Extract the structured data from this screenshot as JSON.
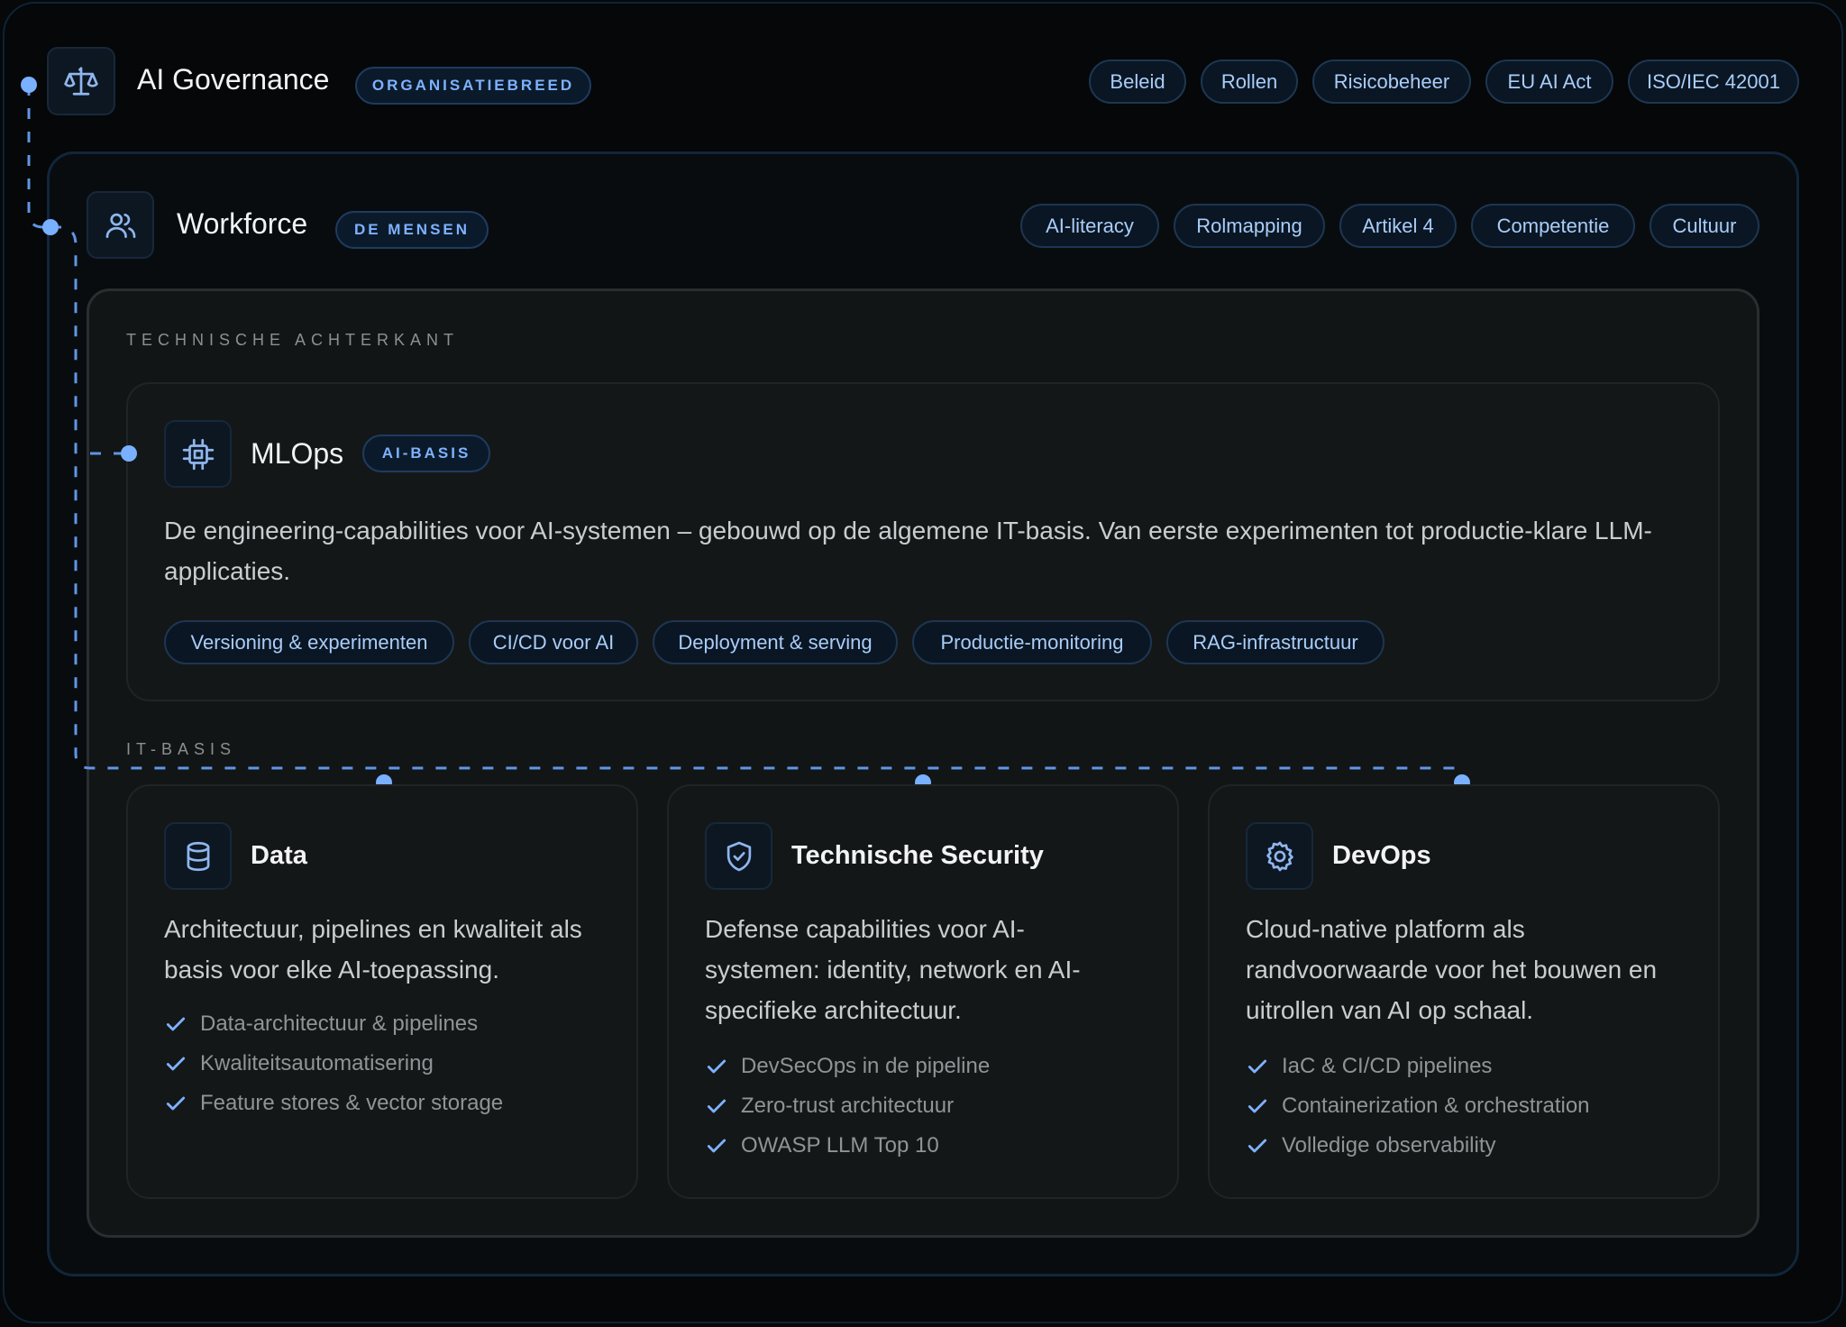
{
  "governance": {
    "title": "AI Governance",
    "badge": "ORGANISATIEBREED",
    "icon": "scale-icon",
    "tags": [
      "Beleid",
      "Rollen",
      "Risicobeheer",
      "EU AI Act",
      "ISO/IEC 42001"
    ]
  },
  "workforce": {
    "title": "Workforce",
    "badge": "DE MENSEN",
    "icon": "users-icon",
    "tags": [
      "AI-literacy",
      "Rolmapping",
      "Artikel 4",
      "Competentie",
      "Cultuur"
    ]
  },
  "technical": {
    "section_label": "TECHNISCHE ACHTERKANT",
    "mlops": {
      "title": "MLOps",
      "badge": "AI-BASIS",
      "icon": "cpu-chip-icon",
      "description": "De engineering-capabilities voor AI-systemen – gebouwd op de algemene IT-basis. Van eerste experimenten tot productie-klare LLM-applicaties.",
      "tags": [
        "Versioning & experimenten",
        "CI/CD voor AI",
        "Deployment & serving",
        "Productie-monitoring",
        "RAG-infrastructuur"
      ]
    },
    "it_basis": {
      "section_label": "IT-BASIS",
      "cards": [
        {
          "title": "Data",
          "icon": "database-icon",
          "description": "Architectuur, pipelines en kwaliteit als basis voor elke AI-toepassing.",
          "features": [
            "Data-architectuur & pipelines",
            "Kwaliteitsautomatisering",
            "Feature stores & vector storage"
          ]
        },
        {
          "title": "Technische Security",
          "icon": "shield-icon",
          "description": "Defense capabilities voor AI-systemen: identity, network en AI-specifieke architectuur.",
          "features": [
            "DevSecOps in de pipeline",
            "Zero-trust architectuur",
            "OWASP LLM Top 10"
          ]
        },
        {
          "title": "DevOps",
          "icon": "gear-icon",
          "description": "Cloud-native platform als randvoorwaarde voor het bouwen en uitrollen van AI op schaal.",
          "features": [
            "IaC & CI/CD pipelines",
            "Containerization & orchestration",
            "Volledige observability"
          ]
        }
      ]
    }
  },
  "colors": {
    "accent": "#79b0ff",
    "background": "#060809",
    "pill_text": "#a9cdf8"
  }
}
